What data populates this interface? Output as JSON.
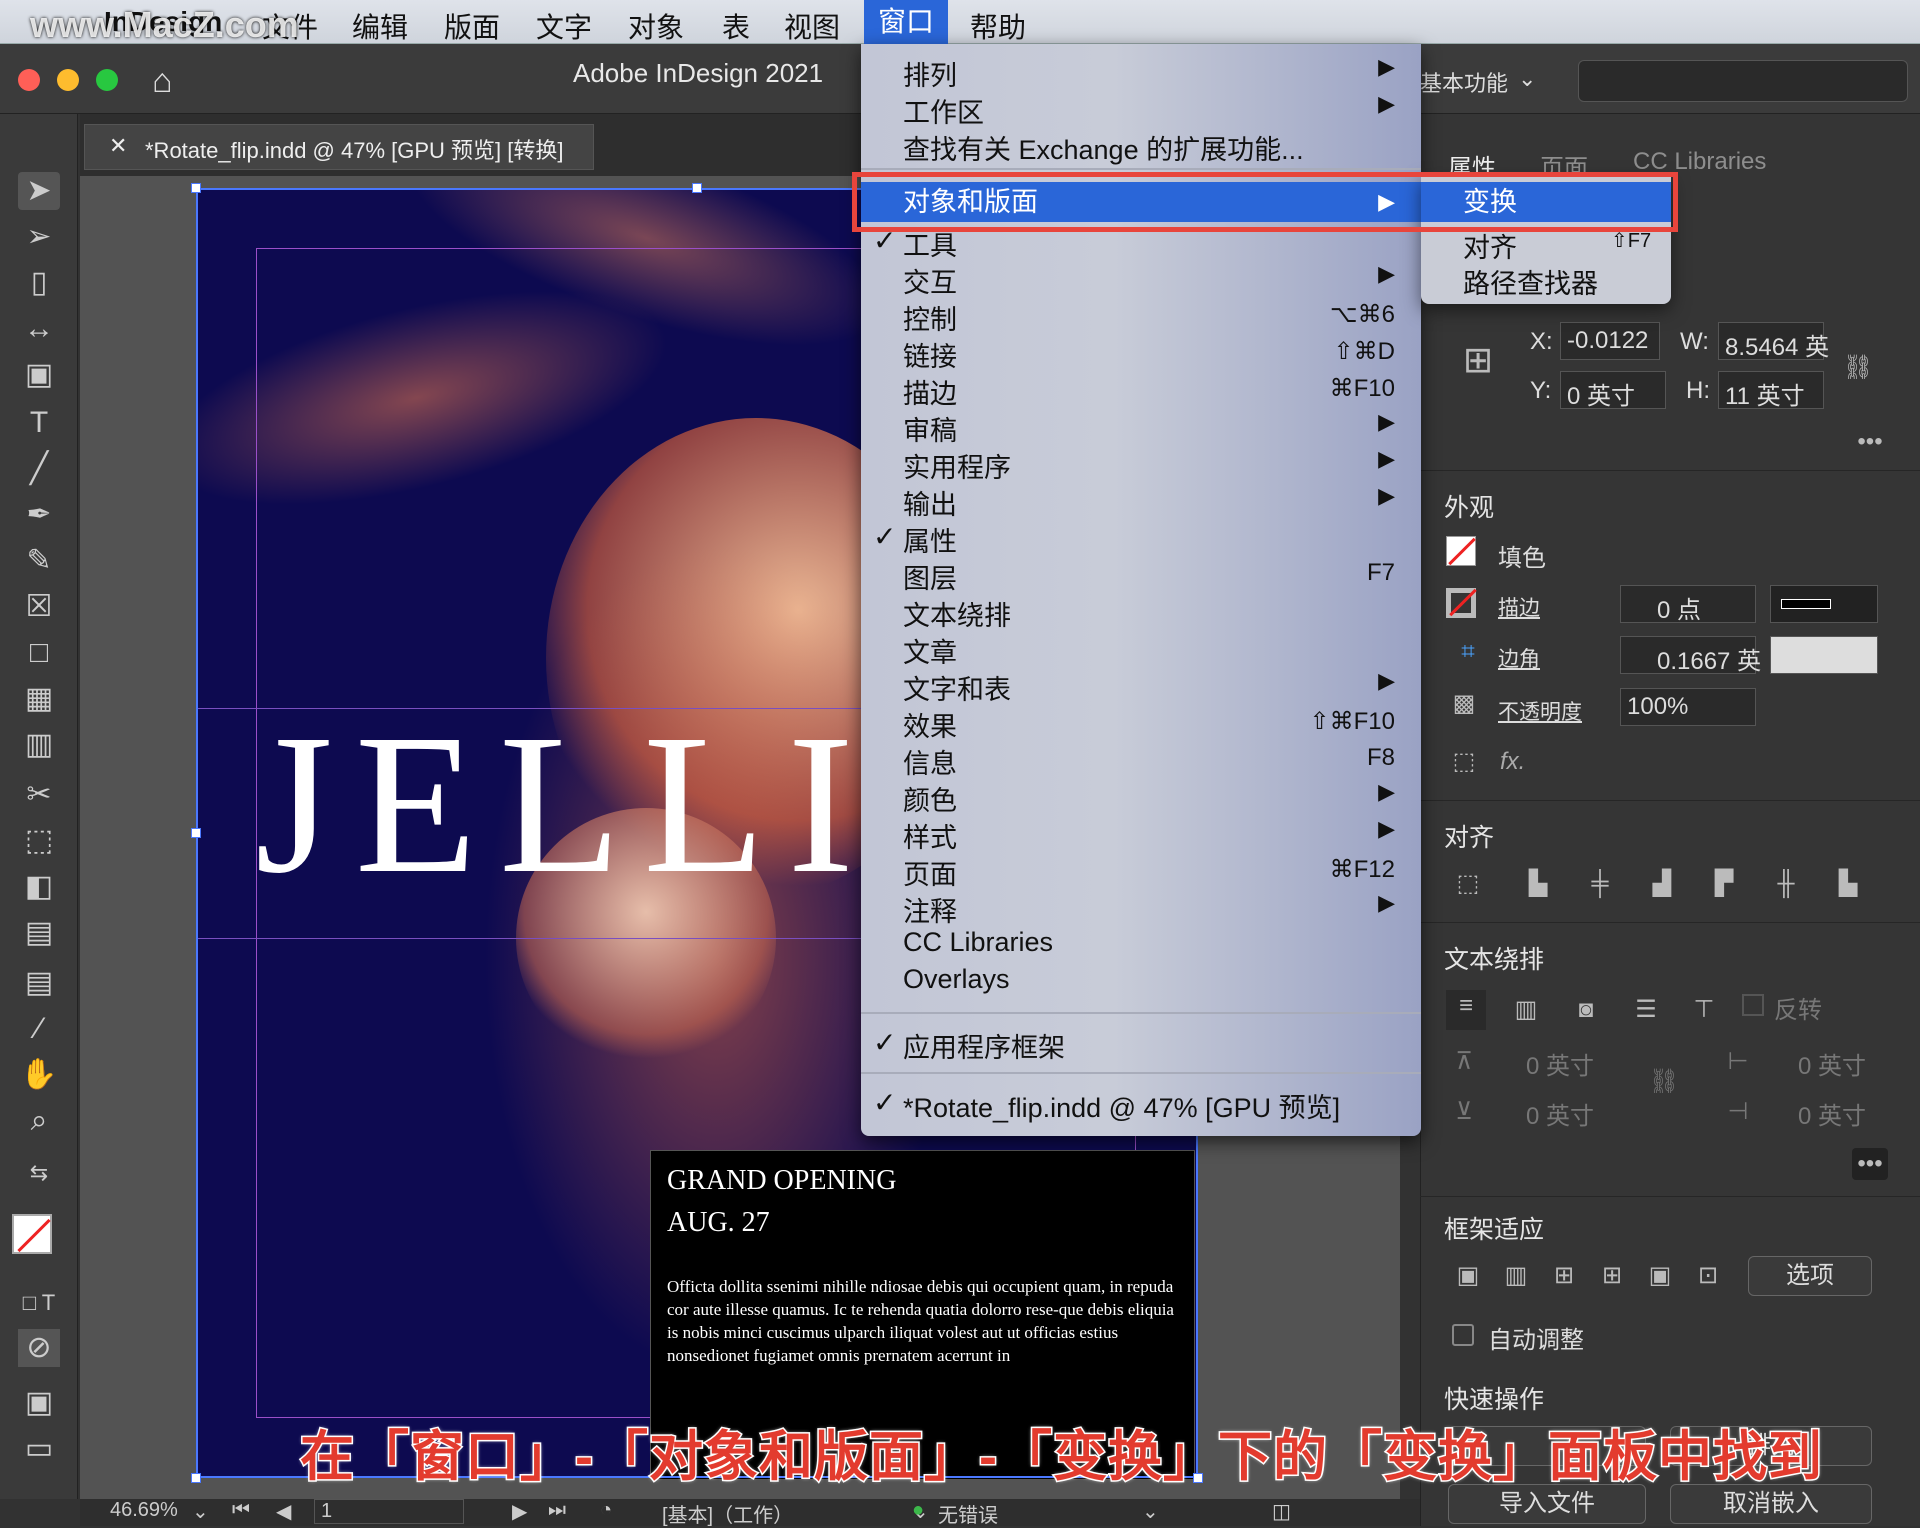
{
  "menubar": {
    "items": [
      "InDesign",
      "文件",
      "编辑",
      "版面",
      "文字",
      "对象",
      "表",
      "视图",
      "窗口",
      "帮助"
    ],
    "watermark": "www.MacZ.com"
  },
  "window": {
    "title": "Adobe InDesign 2021",
    "workspace": "基本功能"
  },
  "doc_tab": {
    "label": "*Rotate_flip.indd @ 47% [GPU 预览] [转换]"
  },
  "window_menu": {
    "items": [
      {
        "label": "排列",
        "shortcut": "",
        "arrow": "▶",
        "check": ""
      },
      {
        "label": "工作区",
        "shortcut": "",
        "arrow": "▶",
        "check": ""
      },
      {
        "label": "查找有关 Exchange 的扩展功能...",
        "shortcut": "",
        "arrow": "",
        "check": ""
      },
      {
        "label": "对象和版面",
        "shortcut": "",
        "arrow": "▶",
        "check": ""
      },
      {
        "label": "工具",
        "shortcut": "",
        "arrow": "",
        "check": "✓"
      },
      {
        "label": "交互",
        "shortcut": "",
        "arrow": "▶",
        "check": ""
      },
      {
        "label": "控制",
        "shortcut": "⌥⌘6",
        "arrow": "",
        "check": ""
      },
      {
        "label": "链接",
        "shortcut": "⇧⌘D",
        "arrow": "",
        "check": ""
      },
      {
        "label": "描边",
        "shortcut": "⌘F10",
        "arrow": "",
        "check": ""
      },
      {
        "label": "审稿",
        "shortcut": "",
        "arrow": "▶",
        "check": ""
      },
      {
        "label": "实用程序",
        "shortcut": "",
        "arrow": "▶",
        "check": ""
      },
      {
        "label": "输出",
        "shortcut": "",
        "arrow": "▶",
        "check": ""
      },
      {
        "label": "属性",
        "shortcut": "",
        "arrow": "",
        "check": "✓"
      },
      {
        "label": "图层",
        "shortcut": "F7",
        "arrow": "",
        "check": ""
      },
      {
        "label": "文本绕排",
        "shortcut": "",
        "arrow": "",
        "check": ""
      },
      {
        "label": "文章",
        "shortcut": "",
        "arrow": "",
        "check": ""
      },
      {
        "label": "文字和表",
        "shortcut": "",
        "arrow": "▶",
        "check": ""
      },
      {
        "label": "效果",
        "shortcut": "⇧⌘F10",
        "arrow": "",
        "check": ""
      },
      {
        "label": "信息",
        "shortcut": "F8",
        "arrow": "",
        "check": ""
      },
      {
        "label": "颜色",
        "shortcut": "",
        "arrow": "▶",
        "check": ""
      },
      {
        "label": "样式",
        "shortcut": "",
        "arrow": "▶",
        "check": ""
      },
      {
        "label": "页面",
        "shortcut": "⌘F12",
        "arrow": "",
        "check": ""
      },
      {
        "label": "注释",
        "shortcut": "",
        "arrow": "▶",
        "check": ""
      },
      {
        "label": "CC Libraries",
        "shortcut": "",
        "arrow": "",
        "check": ""
      },
      {
        "label": "Overlays",
        "shortcut": "",
        "arrow": "",
        "check": ""
      }
    ],
    "app_frame": "应用程序框架",
    "doc_item": "*Rotate_flip.indd @ 47% [GPU 预览]"
  },
  "submenu": {
    "items": [
      "变换",
      "对齐",
      "路径查找器"
    ],
    "align_shortcut": "⇧F7"
  },
  "panel": {
    "tabs": [
      "属性",
      "页面",
      "CC Libraries"
    ],
    "transform": {
      "x_label": "X:",
      "x": "-0.0122",
      "w_label": "W:",
      "w": "8.5464 英",
      "y_label": "Y:",
      "y": "0 英寸",
      "h_label": "H:",
      "h": "11 英寸"
    },
    "appearance": {
      "title": "外观",
      "fill": "填色",
      "stroke": "描边",
      "stroke_val": "0 点",
      "corner": "边角",
      "corner_val": "0.1667 英",
      "opacity": "不透明度",
      "opacity_val": "100%",
      "fx": "fx."
    },
    "align": {
      "title": "对齐"
    },
    "wrap": {
      "title": "文本绕排",
      "invert": "反转",
      "top": "0 英寸",
      "bottom": "0 英寸",
      "left": "0 英寸",
      "right": "0 英寸"
    },
    "fit": {
      "title": "框架适应",
      "options": "选项",
      "auto": "自动调整"
    },
    "quick": {
      "title": "快速操作",
      "arrange": "排列",
      "import": "导入文件",
      "unembed": "取消嵌入"
    }
  },
  "canvas": {
    "headline": "JELLI",
    "info_title": "GRAND OPENING",
    "info_date": "AUG. 27",
    "info_body": "Officta dollita ssenimi nihille ndiosae debis qui occupient quam, in repuda cor aute illesse quamus. Ic te rehenda quatia dolorro rese-que debis eliquia is nobis minci cuscimus ulparch iliquat volest aut ut officias estius nonsedionet fugiamet omnis prernatem acerrunt in"
  },
  "status": {
    "zoom": "46.69%",
    "page": "1",
    "style": "[基本]（工作）",
    "errors": "无错误"
  },
  "caption": "在「窗口」-「对象和版面」-「变换」下的「变换」面板中找到"
}
